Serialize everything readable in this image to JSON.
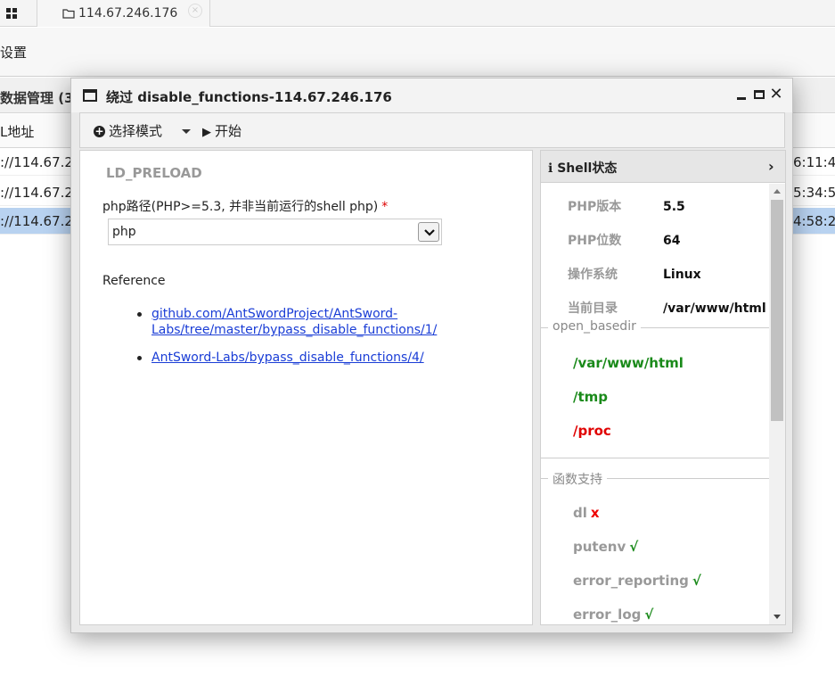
{
  "app": {
    "tab": {
      "label": "114.67.246.176"
    },
    "settings_label": "设置",
    "panel_title": "数据管理 (3)",
    "column_label": "L地址",
    "rows": [
      {
        "url": "://114.67.2",
        "time": "6:11:4"
      },
      {
        "url": "://114.67.2",
        "time": "5:34:5"
      },
      {
        "url": "://114.67.2",
        "time": "4:58:2"
      }
    ]
  },
  "dialog": {
    "title": "绕过 disable_functions-114.67.246.176",
    "toolbar": {
      "mode_label": "选择模式",
      "start_label": "开始"
    },
    "left": {
      "section_title": "LD_PRELOAD",
      "php_path_label": "php路径(PHP>=5.3, 并非当前运行的shell php)",
      "required_mark": "*",
      "php_path_value": "php",
      "reference_label": "Reference",
      "references": [
        "github.com/AntSwordProject/AntSword-Labs/tree/master/bypass_disable_functions/1/",
        "AntSword-Labs/bypass_disable_functions/4/"
      ]
    },
    "right": {
      "header": "Shell状态",
      "info": [
        {
          "key": "PHP版本",
          "value": "5.5"
        },
        {
          "key": "PHP位数",
          "value": "64"
        },
        {
          "key": "操作系统",
          "value": "Linux"
        },
        {
          "key": "当前目录",
          "value": "/var/www/html"
        }
      ],
      "open_basedir_legend": "open_basedir",
      "open_basedir": [
        {
          "path": "/var/www/html",
          "color": "#1a8a1a"
        },
        {
          "path": "/tmp",
          "color": "#1a8a1a"
        },
        {
          "path": "/proc",
          "color": "#e00000"
        }
      ],
      "functions_legend": "函数支持",
      "functions": [
        {
          "name": "dl",
          "status": "x"
        },
        {
          "name": "putenv",
          "status": "√"
        },
        {
          "name": "error_reporting",
          "status": "√"
        },
        {
          "name": "error_log",
          "status": "√"
        }
      ]
    }
  }
}
